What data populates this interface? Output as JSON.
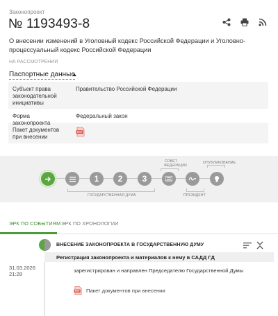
{
  "header": {
    "kicker": "Законопроект",
    "number": "№ 1193493-8",
    "title": "О внесении изменений в Уголовный кодекс Российской Федерации и Уголовно-процессуальный кодекс Российской Федерации",
    "status": "НА РАССМОТРЕНИИ",
    "actions": [
      "share-icon",
      "print-icon",
      "rss-icon"
    ]
  },
  "passport": {
    "toggle_label": "Паспортные данные",
    "rows": [
      {
        "key": "Субъект права законодательной инициативы",
        "value": "Правительство Российской Федерации"
      },
      {
        "key": "Форма законопроекта",
        "value": "Федеральный закон"
      },
      {
        "key": "Пакет документов при внесении",
        "value": "",
        "icon": "pdf-icon"
      }
    ]
  },
  "stages": {
    "steps": [
      {
        "label": "",
        "icon": "arrow-right-icon",
        "state": "active"
      },
      {
        "label": "",
        "icon": "list-icon",
        "state": "pending"
      },
      {
        "label": "1",
        "state": "pending"
      },
      {
        "label": "2",
        "state": "pending"
      },
      {
        "label": "3",
        "state": "pending"
      },
      {
        "label": "",
        "icon": "council-icon",
        "state": "pending"
      },
      {
        "label": "",
        "icon": "signature-icon",
        "state": "pending"
      },
      {
        "label": "",
        "icon": "seal-icon",
        "state": "pending"
      }
    ],
    "labels": {
      "duma": "ГОСУДАРСТВЕННАЯ ДУМА",
      "council_line1": "СОВЕТ",
      "council_line2": "ФЕДЕРАЦИИ",
      "president": "ПРЕЗИДЕНТ",
      "publication": "ОПУБЛИКОВАНИЕ"
    }
  },
  "tabs": {
    "by_events": "ЭРК ПО СОБЫТИЯМ",
    "by_chronology": "ЭРК ПО ХРОНОЛОГИИ"
  },
  "timeline": {
    "stage_title": "ВНЕСЕНИЕ ЗАКОНОПРОЕКТА В ГОСУДАРСТВЕННУЮ ДУМУ",
    "event_title": "Регистрация законопроекта и материалов к нему в САДД ГД",
    "date": "31.03.2026",
    "time": "21:28",
    "text": "зарегистрирован и направлен Председателю Государственной Думы",
    "doc_label": "Пакет документов при внесении"
  },
  "colors": {
    "accent": "#5aa640",
    "inactive": "#9a9a9a",
    "pdf": "#e05548"
  }
}
